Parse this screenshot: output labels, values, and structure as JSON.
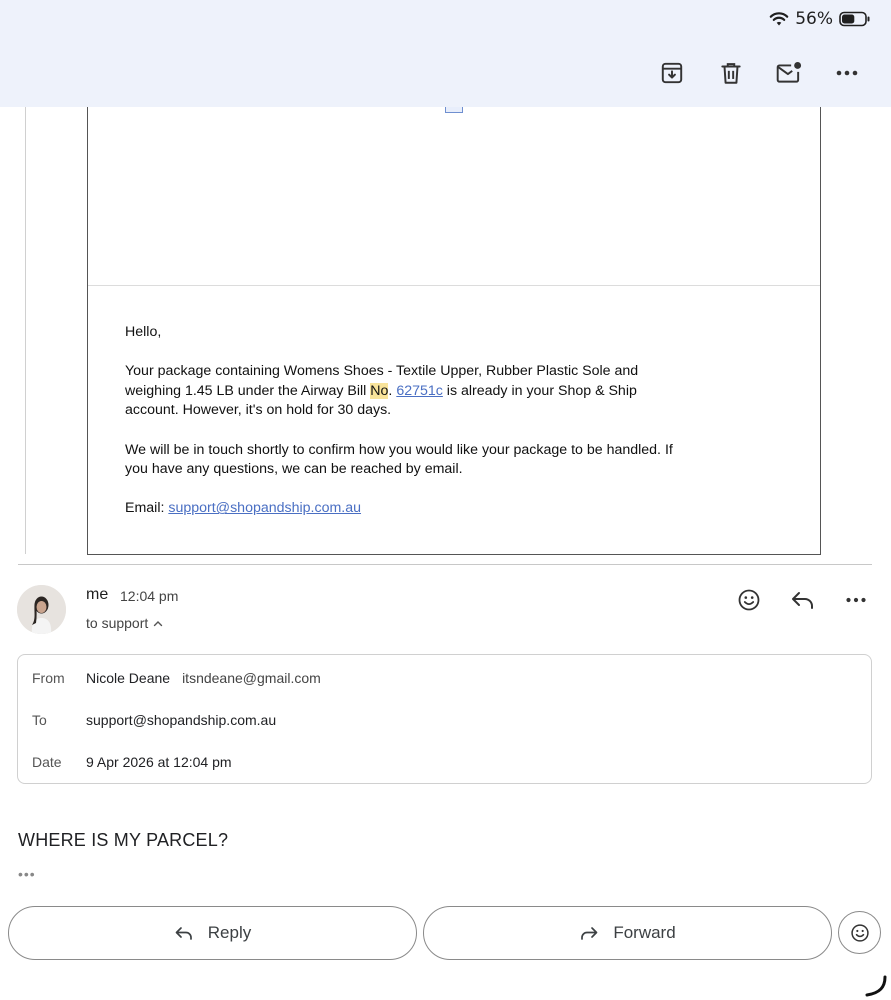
{
  "status_bar": {
    "battery_percent": "56%",
    "battery_level": 0.56
  },
  "toolbar": {
    "icons": [
      "archive-icon",
      "delete-icon",
      "mark-unread-icon",
      "more-icon"
    ]
  },
  "quoted_message": {
    "greeting": "Hello,",
    "para1_a": "Your package containing Womens Shoes - Textile Upper, Rubber Plastic Sole and weighing 1.45 LB under the Airway Bill ",
    "para1_highlight": "No",
    "para1_dot": ". ",
    "para1_link": "62751c",
    "para1_b": " is already in your Shop & Ship account. However, it's on hold for 30 days.",
    "para2": "We will be in touch shortly to confirm how you would like your package to be handled. If you have any questions, we can be reached by email.",
    "email_label": "Email: ",
    "email_link": "support@shopandship.com.au"
  },
  "message": {
    "sender": "me",
    "time": "12:04 pm",
    "to_line": "to support",
    "details": {
      "from_label": "From",
      "from_name": "Nicole Deane",
      "from_email": "itsndeane@gmail.com",
      "to_label": "To",
      "to_value": "support@shopandship.com.au",
      "date_label": "Date",
      "date_value": "9 Apr 2026 at 12:04 pm"
    },
    "body": "WHERE IS MY PARCEL?",
    "trimmed": "•••"
  },
  "actions": {
    "reply_label": "Reply",
    "forward_label": "Forward"
  },
  "colors": {
    "topbar_bg": "#eef2fb",
    "link": "#4a6fc3",
    "highlight": "#f8e39a"
  }
}
